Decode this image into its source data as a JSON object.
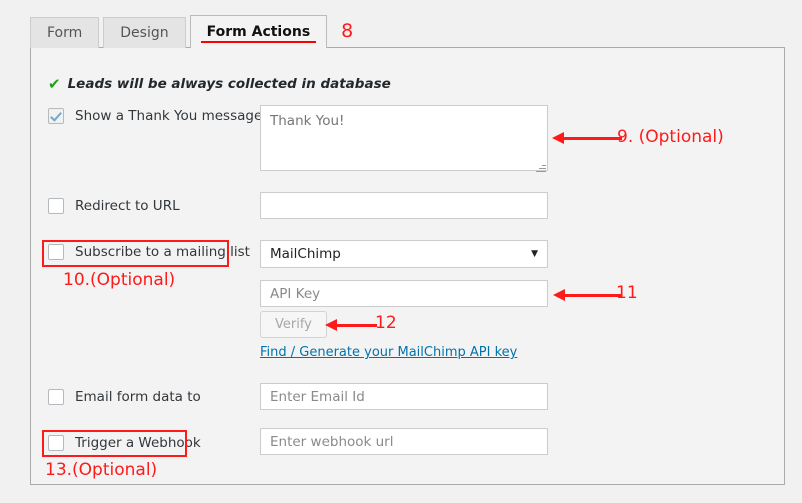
{
  "tabs": [
    {
      "label": "Form",
      "active": false
    },
    {
      "label": "Design",
      "active": false
    },
    {
      "label": "Form Actions",
      "active": true
    }
  ],
  "tab_annotation": "8",
  "notice": {
    "icon": "check-icon",
    "check_glyph": "✔",
    "text": "Leads will be always collected in database"
  },
  "rows": {
    "thank_you": {
      "label": "Show a Thank You message",
      "checked": true,
      "textarea_placeholder": "Thank You!"
    },
    "redirect": {
      "label": "Redirect to URL",
      "checked": false,
      "input_placeholder": "",
      "input_value": ""
    },
    "subscribe": {
      "label": "Subscribe to a mailing list",
      "checked": false,
      "provider_selected": "MailChimp",
      "provider_caret": "▼",
      "api_key_placeholder": "API Key",
      "api_key_value": "",
      "verify_label": "Verify",
      "help_link": "Find / Generate your MailChimp API key"
    },
    "email": {
      "label": "Email form data to",
      "checked": false,
      "input_placeholder": "Enter Email Id",
      "input_value": ""
    },
    "webhook": {
      "label": "Trigger a Webhook",
      "checked": false,
      "input_placeholder": "Enter webhook url",
      "input_value": ""
    }
  },
  "annotations": {
    "a9": "9. (Optional)",
    "a10": "10.(Optional)",
    "a11": "11",
    "a12": "12",
    "a13": "13.(Optional)"
  },
  "colors": {
    "annotation_red": "#ff1a1a",
    "link_blue": "#0073aa",
    "check_green": "#1fa11f",
    "checkbox_blue": "#6fa8d0",
    "panel_bg": "#f3f3f3",
    "page_bg": "#f1f1f1"
  }
}
